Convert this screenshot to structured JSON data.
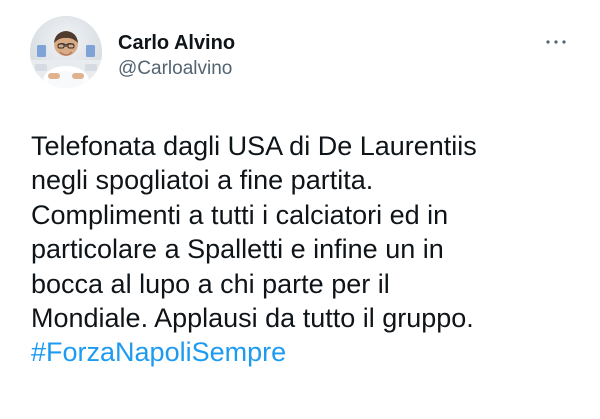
{
  "tweet": {
    "author": {
      "name": "Carlo Alvino",
      "handle": "@Carloalvino",
      "avatar_icon": "user-avatar-icon"
    },
    "menu": {
      "icon": "more-horizontal-icon",
      "color": "#536471"
    },
    "text_lines": [
      "Telefonata dagli USA di De Laurentiis",
      "negli spogliatoi a fine partita.",
      "Complimenti a tutti i calciatori ed in",
      "particolare a Spalletti e infine un in",
      "bocca al lupo a chi parte per il",
      "Mondiale. Applausi da tutto il gruppo."
    ],
    "hashtag": "#ForzaNapoliSempre",
    "colors": {
      "text": "#0f1419",
      "secondary": "#536471",
      "link": "#1d9bf0",
      "background": "#ffffff"
    }
  }
}
